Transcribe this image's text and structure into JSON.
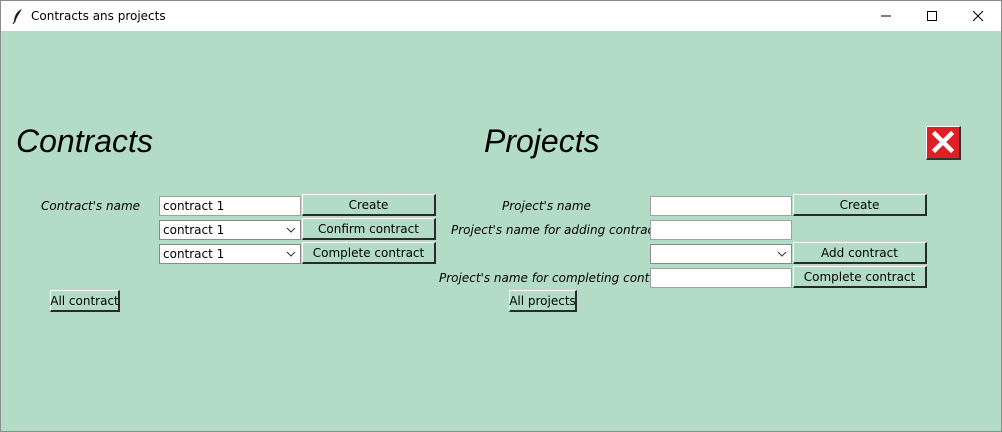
{
  "window": {
    "title": "Contracts ans projects"
  },
  "contracts": {
    "heading": "Contracts",
    "name_label": "Contract's name",
    "name_value": "contract 1",
    "create_label": "Create",
    "confirm_select": "contract 1",
    "confirm_label": "Confirm contract",
    "complete_select": "contract 1",
    "complete_label": "Complete contract",
    "all_label": "All contract"
  },
  "projects": {
    "heading": "Projects",
    "name_label": "Project's name",
    "name_value": "",
    "create_label": "Create",
    "add_name_label": "Project's name for adding contract",
    "add_name_value": "",
    "add_select": "",
    "add_contract_label": "Add contract",
    "complete_name_label": "Project's name for completing contract",
    "complete_name_value": "",
    "complete_contract_label": "Complete contract",
    "all_label": "All projects"
  },
  "icons": {
    "app": "feather-icon",
    "exit": "close-x-icon"
  },
  "colors": {
    "background": "#b3dcc7",
    "exit_button": "#e01e25"
  }
}
